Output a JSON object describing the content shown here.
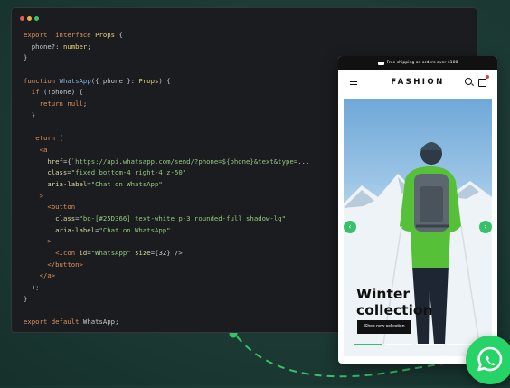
{
  "colors": {
    "background": "#1c3a34",
    "editor": "#1b1c1f",
    "accent_green": "#39c06a",
    "whatsapp": "#25d366",
    "dots": [
      "#e25b4f",
      "#e7b23f",
      "#3cc36a"
    ]
  },
  "code_lines": [
    [
      [
        "kw",
        "export"
      ],
      [
        "",
        "  "
      ],
      [
        "kw",
        "interface"
      ],
      [
        "",
        " "
      ],
      [
        "ty",
        "Props"
      ],
      [
        "",
        " {"
      ]
    ],
    [
      [
        "",
        "  phone?: "
      ],
      [
        "ty",
        "number"
      ],
      [
        "",
        ";"
      ]
    ],
    [
      [
        "",
        "}"
      ]
    ],
    [
      [
        "",
        ""
      ]
    ],
    [
      [
        "kw",
        "function"
      ],
      [
        "",
        " "
      ],
      [
        "fn",
        "WhatsApp"
      ],
      [
        "",
        "({ phone }: "
      ],
      [
        "ty",
        "Props"
      ],
      [
        "",
        ") {"
      ]
    ],
    [
      [
        "",
        "  "
      ],
      [
        "kw",
        "if"
      ],
      [
        "",
        " (!phone) {"
      ]
    ],
    [
      [
        "",
        "    "
      ],
      [
        "kw",
        "return"
      ],
      [
        "",
        " "
      ],
      [
        "kw",
        "null"
      ],
      [
        "",
        ";"
      ]
    ],
    [
      [
        "",
        "  }"
      ]
    ],
    [
      [
        "",
        ""
      ]
    ],
    [
      [
        "",
        "  "
      ],
      [
        "kw",
        "return"
      ],
      [
        "",
        " ("
      ]
    ],
    [
      [
        "",
        "    "
      ],
      [
        "tg",
        "<a"
      ]
    ],
    [
      [
        "",
        "      "
      ],
      [
        "at",
        "href"
      ],
      [
        "",
        "={"
      ],
      [
        "st",
        "`https://api.whatsapp.com/send/?phone=${phone}&text&type="
      ],
      [
        "",
        "..."
      ]
    ],
    [
      [
        "",
        "      "
      ],
      [
        "at",
        "class"
      ],
      [
        "",
        "="
      ],
      [
        "st",
        "\"fixed bottom-4 right-4 z-50\""
      ]
    ],
    [
      [
        "",
        "      "
      ],
      [
        "at",
        "aria-label"
      ],
      [
        "",
        "="
      ],
      [
        "st",
        "\"Chat on WhatsApp\""
      ]
    ],
    [
      [
        "",
        "    "
      ],
      [
        "tg",
        ">"
      ]
    ],
    [
      [
        "",
        "      "
      ],
      [
        "tg",
        "<button"
      ]
    ],
    [
      [
        "",
        "        "
      ],
      [
        "at",
        "class"
      ],
      [
        "",
        "="
      ],
      [
        "st",
        "\"bg-[#25D366] text-white p-3 rounded-full shadow-lg\""
      ]
    ],
    [
      [
        "",
        "        "
      ],
      [
        "at",
        "aria-label"
      ],
      [
        "",
        "="
      ],
      [
        "st",
        "\"Chat on WhatsApp\""
      ]
    ],
    [
      [
        "",
        "      "
      ],
      [
        "tg",
        ">"
      ]
    ],
    [
      [
        "",
        "        "
      ],
      [
        "tg",
        "<Icon"
      ],
      [
        "",
        " "
      ],
      [
        "at",
        "id"
      ],
      [
        "",
        "="
      ],
      [
        "st",
        "\"WhatsApp\""
      ],
      [
        "",
        " "
      ],
      [
        "at",
        "size"
      ],
      [
        "",
        "={32} />"
      ]
    ],
    [
      [
        "",
        "      "
      ],
      [
        "tg",
        "</button>"
      ]
    ],
    [
      [
        "",
        "    "
      ],
      [
        "tg",
        "</a>"
      ]
    ],
    [
      [
        "",
        "  );"
      ]
    ],
    [
      [
        "",
        "}"
      ]
    ],
    [
      [
        "",
        ""
      ]
    ],
    [
      [
        "kw",
        "export"
      ],
      [
        "",
        " "
      ],
      [
        "kw",
        "default"
      ],
      [
        "",
        " WhatsApp;"
      ]
    ]
  ],
  "phone": {
    "promo": "Free shipping on orders over $100",
    "brand": "FASHION",
    "hero_title_line1": "Winter",
    "hero_title_line2": "collection",
    "hero_button": "Shop new collection",
    "prev_arrow": "‹",
    "next_arrow": "›",
    "icons": [
      "menu-icon",
      "search-icon",
      "bag-icon",
      "truck-icon"
    ]
  },
  "floating_button": {
    "icon": "whatsapp-icon"
  }
}
